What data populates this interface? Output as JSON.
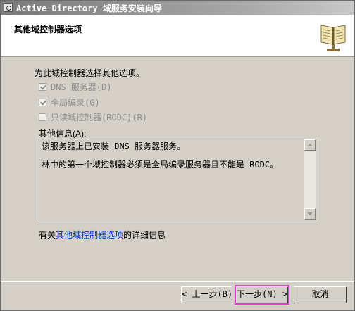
{
  "window": {
    "title": "Active Directory 域服务安装向导",
    "header_title": "其他域控制器选项"
  },
  "options": {
    "intro": "为此域控制器选择其他选项。",
    "items": [
      {
        "label": "DNS 服务器(D)",
        "checked": true,
        "enabled": false
      },
      {
        "label": "全局编录(G)",
        "checked": true,
        "enabled": false
      },
      {
        "label": "只读域控制器(RODC)(R)",
        "checked": false,
        "enabled": false
      }
    ]
  },
  "info": {
    "label": "其他信息(A):",
    "lines": [
      "该服务器上已安装 DNS 服务器服务。",
      "林中的第一个域控制器必须是全局编录服务器且不能是 RODC。"
    ]
  },
  "more_info": {
    "prefix": "有关",
    "link": "其他域控制器选项",
    "suffix": "的详细信息"
  },
  "buttons": {
    "back": "< 上一步(B)",
    "next": "下一步(N) >",
    "cancel": "取消"
  },
  "colors": {
    "dialog_bg": "#d4d0c8",
    "link": "#0033cc",
    "highlight": "#e23ccf"
  }
}
